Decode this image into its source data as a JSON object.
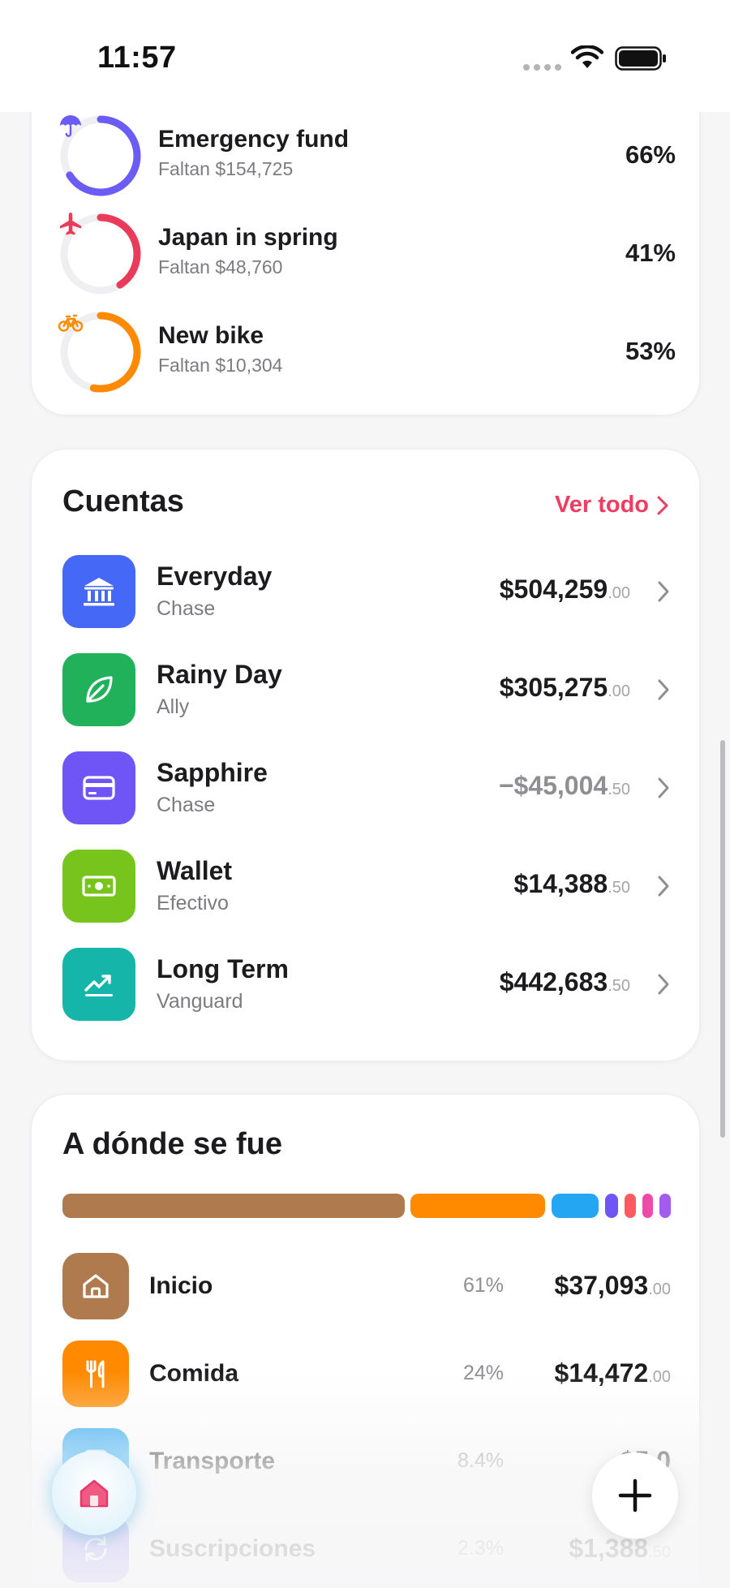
{
  "status_bar": {
    "time": "11:57"
  },
  "goals": [
    {
      "name": "Emergency fund",
      "remaining": "Faltan $154,725",
      "percent": "66%",
      "percent_value": 66,
      "color": "#6b5cf6",
      "icon": "umbrella-icon"
    },
    {
      "name": "Japan in spring",
      "remaining": "Faltan $48,760",
      "percent": "41%",
      "percent_value": 41,
      "color": "#ea3b5b",
      "icon": "airplane-icon"
    },
    {
      "name": "New bike",
      "remaining": "Faltan $10,304",
      "percent": "53%",
      "percent_value": 53,
      "color": "#ff8a00",
      "icon": "bicycle-icon"
    }
  ],
  "accounts": {
    "title": "Cuentas",
    "see_all": "Ver todo",
    "items": [
      {
        "name": "Everyday",
        "bank": "Chase",
        "balance": "$504,259",
        "cents": ".00",
        "color": "#4568f6",
        "icon": "bank-icon"
      },
      {
        "name": "Rainy Day",
        "bank": "Ally",
        "balance": "$305,275",
        "cents": ".00",
        "color": "#20b15a",
        "icon": "leaf-icon"
      },
      {
        "name": "Sapphire",
        "bank": "Chase",
        "balance": "−$45,004",
        "cents": ".50",
        "color": "#7055f6",
        "icon": "credit-card-icon",
        "negative": true
      },
      {
        "name": "Wallet",
        "bank": "Efectivo",
        "balance": "$14,388",
        "cents": ".50",
        "color": "#76c41c",
        "icon": "cash-icon"
      },
      {
        "name": "Long Term",
        "bank": "Vanguard",
        "balance": "$442,683",
        "cents": ".50",
        "color": "#16b5aa",
        "icon": "chart-up-icon"
      }
    ]
  },
  "spending": {
    "title": "A dónde se fue",
    "bar_segments": [
      {
        "category": "Inicio",
        "share": 61,
        "color": "#b07a4f"
      },
      {
        "category": "Comida",
        "share": 24,
        "color": "#ff8a00"
      },
      {
        "category": "Transporte",
        "share": 8.4,
        "color": "#24a6f2"
      },
      {
        "category": "Suscripciones",
        "share": 2.3,
        "color": "#7055f6"
      },
      {
        "category": "other-1",
        "share": 1.5,
        "color": "#ff5a5f"
      },
      {
        "category": "other-2",
        "share": 1.5,
        "color": "#ee4aa7"
      },
      {
        "category": "other-3",
        "share": 1.3,
        "color": "#a25cf0"
      }
    ],
    "categories": [
      {
        "name": "Inicio",
        "percent": "61%",
        "amount": "$37,093",
        "cents": ".00",
        "color": "#b07a4f",
        "icon": "house-icon"
      },
      {
        "name": "Comida",
        "percent": "24%",
        "amount": "$14,472",
        "cents": ".00",
        "color": "#ff8a00",
        "icon": "fork-knife-icon"
      },
      {
        "name": "Transporte",
        "percent": "8.4%",
        "amount": "$5,0",
        "cents": "",
        "color": "#24a6f2",
        "icon": "transport-icon"
      },
      {
        "name": "Suscripciones",
        "percent": "2.3%",
        "amount": "$1,388",
        "cents": ".50",
        "color": "#7055f6",
        "icon": "repeat-icon"
      }
    ]
  }
}
